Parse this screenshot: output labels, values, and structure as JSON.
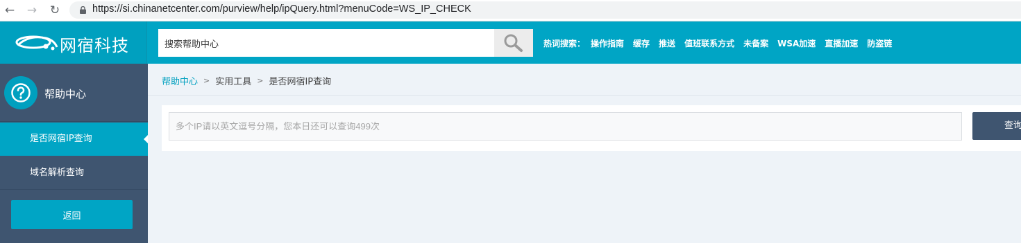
{
  "browser": {
    "url": "https://si.chinanetcenter.com/purview/help/ipQuery.html?menuCode=WS_IP_CHECK"
  },
  "header": {
    "logo_text": "网宿科技",
    "search_placeholder": "搜索帮助中心",
    "hot_label": "热词搜索：",
    "hot_links": [
      "操作指南",
      "缓存",
      "推送",
      "值班联系方式",
      "未备案",
      "WSA加速",
      "直播加速",
      "防盗链"
    ]
  },
  "sidebar": {
    "title": "帮助中心",
    "items": [
      {
        "label": "是否网宿IP查询",
        "active": true
      },
      {
        "label": "域名解析查询",
        "active": false
      }
    ],
    "back_label": "返回"
  },
  "breadcrumb": {
    "home": "帮助中心",
    "category": "实用工具",
    "current": "是否网宿IP查询",
    "separator": ">"
  },
  "query": {
    "placeholder": "多个IP请以英文逗号分隔，您本日还可以查询499次",
    "button_label": "查询"
  },
  "colors": {
    "accent": "#00a5c5",
    "sidebar": "#3f5570",
    "page_bg": "#eef3f8"
  }
}
